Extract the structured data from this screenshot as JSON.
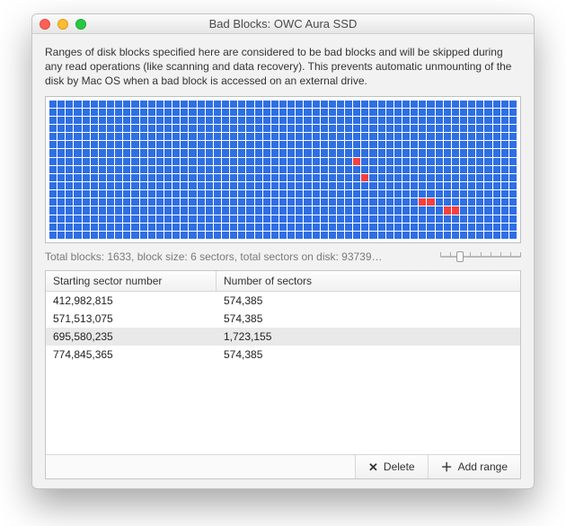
{
  "window": {
    "title": "Bad Blocks: OWC Aura SSD"
  },
  "description": "Ranges of disk blocks specified here are considered to be bad blocks and will be skipped during any read operations (like scanning and data recovery). This prevents automatic unmounting of the disk by Mac OS when a bad block is accessed on an external drive.",
  "block_map": {
    "cols": 57,
    "rows": 17,
    "bad_cells": [
      {
        "row": 7,
        "col": 37
      },
      {
        "row": 9,
        "col": 38
      },
      {
        "row": 12,
        "col": 45
      },
      {
        "row": 12,
        "col": 46
      },
      {
        "row": 13,
        "col": 48
      },
      {
        "row": 13,
        "col": 49
      }
    ]
  },
  "status_line": "Total blocks: 1633, block size: 6 sectors, total sectors on disk: 93739…",
  "table": {
    "columns": [
      "Starting sector number",
      "Number of sectors"
    ],
    "rows": [
      {
        "start": "412,982,815",
        "count": "574,385",
        "selected": false
      },
      {
        "start": "571,513,075",
        "count": "574,385",
        "selected": false
      },
      {
        "start": "695,580,235",
        "count": "1,723,155",
        "selected": true
      },
      {
        "start": "774,845,365",
        "count": "574,385",
        "selected": false
      }
    ]
  },
  "buttons": {
    "delete": "Delete",
    "add_range": "Add range"
  }
}
